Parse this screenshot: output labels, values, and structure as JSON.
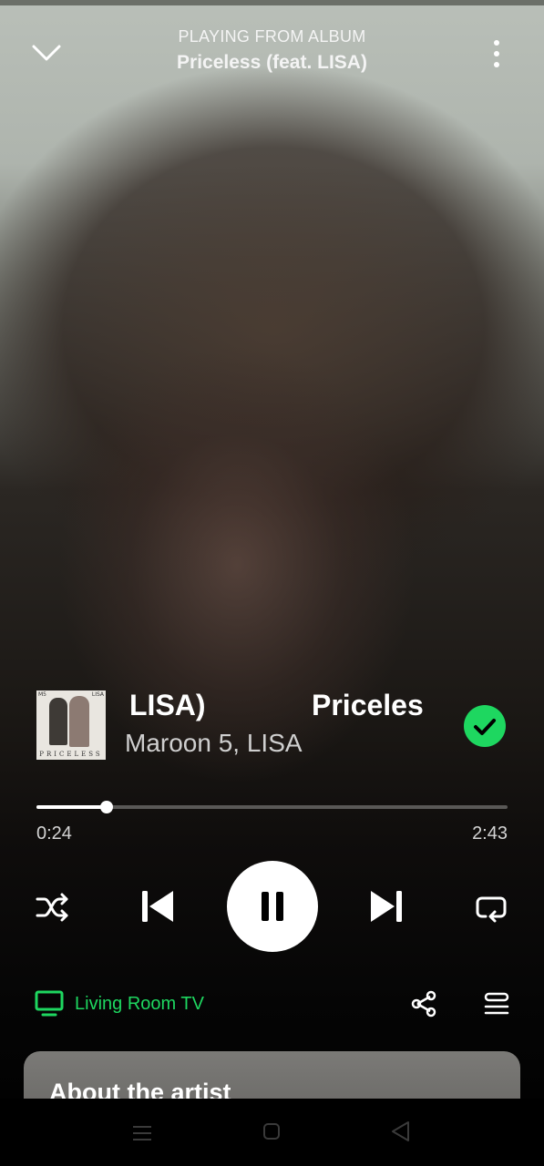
{
  "header": {
    "context_label": "PLAYING FROM ALBUM",
    "album_name": "Priceless (feat. LISA)",
    "collapse_icon": "chevron-down-icon",
    "more_icon": "more-vertical-icon"
  },
  "track": {
    "title_fragment_tail": "LISA)",
    "title_fragment_head": "Priceles",
    "artists": "Maroon 5, LISA",
    "album_art": {
      "caption": "PRICELESS",
      "corner_left": "M5",
      "corner_right": "LISA"
    },
    "liked": true,
    "like_icon": "check-circle-icon"
  },
  "playback": {
    "elapsed": "0:24",
    "total": "2:43",
    "progress": 0.149,
    "is_playing": true
  },
  "controls": {
    "shuffle_icon": "shuffle-icon",
    "previous_icon": "skip-previous-icon",
    "pause_icon": "pause-icon",
    "next_icon": "skip-next-icon",
    "repeat_icon": "repeat-icon"
  },
  "device": {
    "name": "Living Room TV",
    "icon": "tv-icon",
    "color": "#1ed760"
  },
  "actions": {
    "share_icon": "share-icon",
    "queue_icon": "queue-icon"
  },
  "about": {
    "title": "About the artist"
  },
  "colors": {
    "accent": "#1ed760",
    "text_primary": "#ffffff",
    "text_secondary": "#cfcfcf"
  }
}
